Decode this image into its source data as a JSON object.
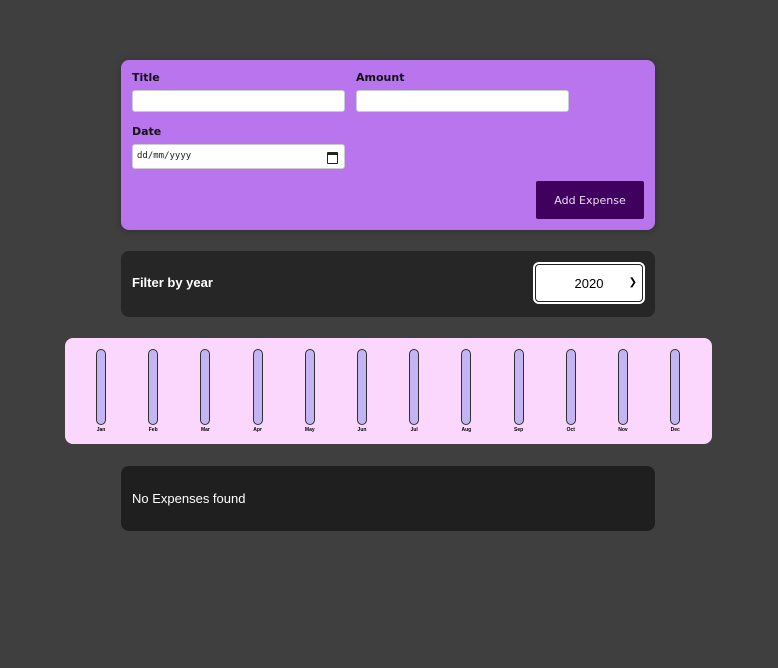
{
  "form": {
    "title_label": "Title",
    "title_value": "",
    "amount_label": "Amount",
    "amount_value": "",
    "date_label": "Date",
    "date_placeholder": "dd/mm/yyyy",
    "submit_label": "Add Expense"
  },
  "filter": {
    "label": "Filter by year",
    "selected_year": "2020"
  },
  "chart_data": {
    "type": "bar",
    "categories": [
      "Jan",
      "Feb",
      "Mar",
      "Apr",
      "May",
      "Jun",
      "Jul",
      "Aug",
      "Sep",
      "Oct",
      "Nov",
      "Dec"
    ],
    "values": [
      0,
      0,
      0,
      0,
      0,
      0,
      0,
      0,
      0,
      0,
      0,
      0
    ]
  },
  "expenses": {
    "empty_message": "No Expenses found"
  },
  "colors": {
    "form_bg": "#b975ee",
    "button_bg": "#40005d",
    "chart_bg": "#fbd6fd",
    "bar_empty": "#c3b4f3",
    "bar_fill": "#4826b9",
    "page_bg": "#3f3f3f"
  }
}
